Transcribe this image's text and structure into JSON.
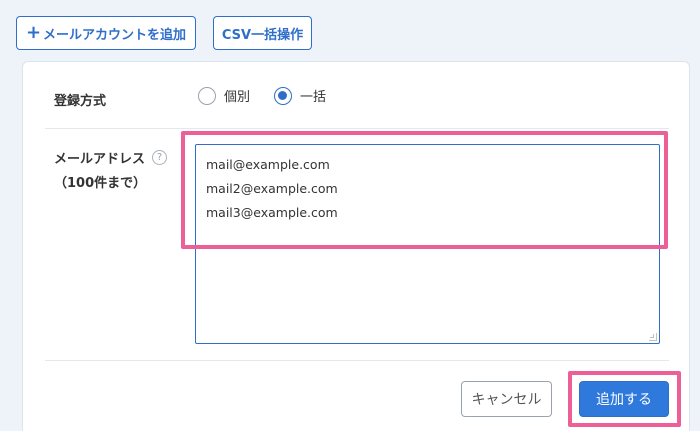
{
  "toolbar": {
    "add_account_label": "メールアカウントを追加",
    "csv_label": "CSV一括操作"
  },
  "form": {
    "method_label": "登録方式",
    "method_options": [
      {
        "label": "個別",
        "selected": false
      },
      {
        "label": "一括",
        "selected": true
      }
    ],
    "email_label": "メールアドレス",
    "email_limit": "（100件まで）",
    "help_glyph": "?",
    "email_lines": [
      "mail@example.com",
      "mail2@example.com",
      "mail3@example.com"
    ]
  },
  "actions": {
    "cancel_label": "キャンセル",
    "submit_label": "追加する"
  },
  "colors": {
    "accent": "#2f6fca",
    "primary_button": "#2f78dc",
    "highlight": "#ec5f97",
    "background": "#eef3fa"
  }
}
